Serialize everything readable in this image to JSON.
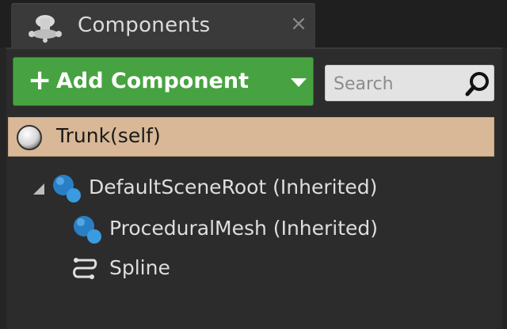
{
  "tab": {
    "title": "Components",
    "close_glyph": "×",
    "icon": "components-icon"
  },
  "toolbar": {
    "add_plus": "+",
    "add_label": "Add Component",
    "add_button_color": "#47a341",
    "search_placeholder": "Search",
    "search_value": ""
  },
  "tree": {
    "self": {
      "label": "Trunk(self)",
      "icon": "sphere-icon",
      "highlight_color": "#d8b896"
    },
    "items": [
      {
        "label": "DefaultSceneRoot (Inherited)",
        "icon": "scene-component-icon",
        "expanded": true
      },
      {
        "label": "ProceduralMesh (Inherited)",
        "icon": "scene-component-icon"
      },
      {
        "label": "Spline",
        "icon": "spline-icon"
      }
    ]
  }
}
